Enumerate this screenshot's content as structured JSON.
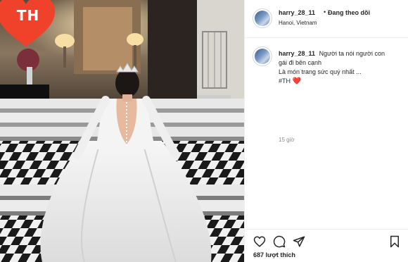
{
  "badge": {
    "text": "TH",
    "color": "#f0412b"
  },
  "post": {
    "username": "harry_28_11",
    "separator": "•",
    "follow_status": "Đang theo dõi",
    "location": "Hanoi, Vietnam",
    "caption_lines": [
      "Người ta nói người con",
      "gái đi bên cạnh",
      "Là món trang sức quý nhất ..."
    ],
    "hashtag": "#TH",
    "heart_emoji": "❤️",
    "time_ago": "15 giờ",
    "likes": "687 lượt thích"
  },
  "icons": {
    "like": "heart-outline-icon",
    "comment": "comment-bubble-icon",
    "share": "paper-plane-icon",
    "save": "bookmark-icon"
  }
}
